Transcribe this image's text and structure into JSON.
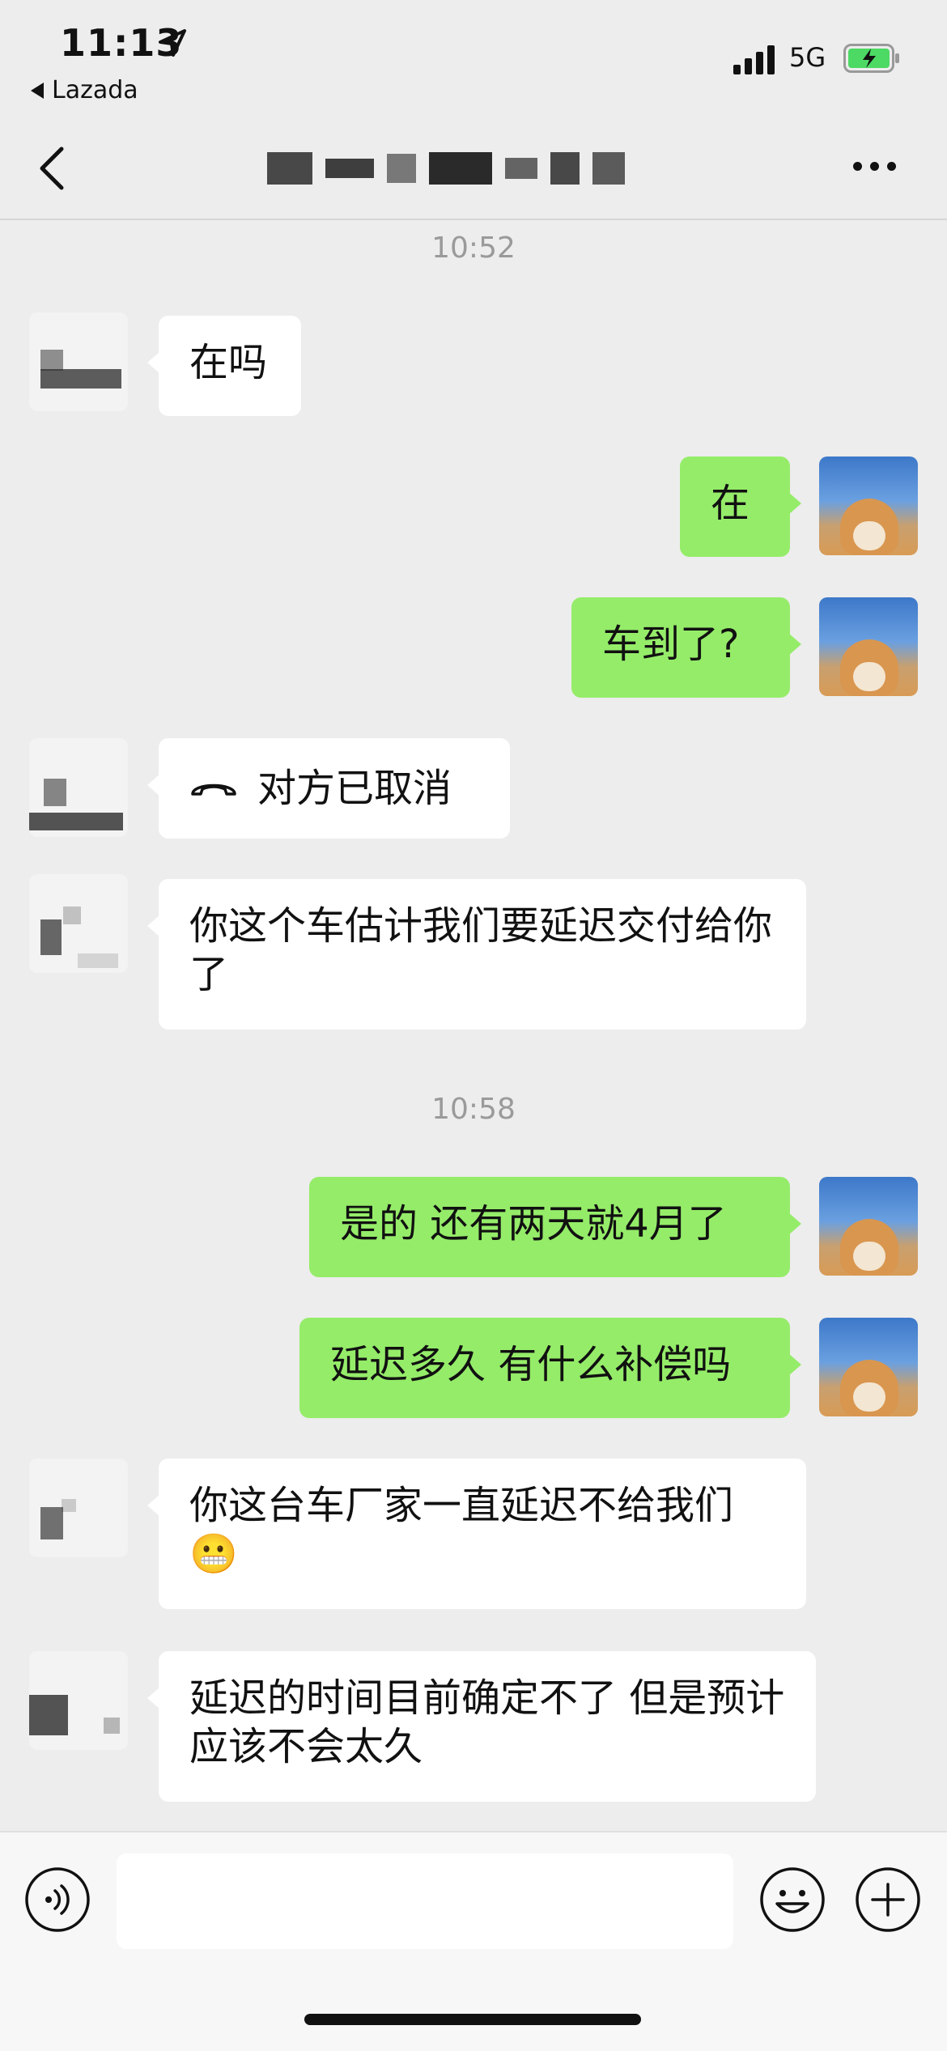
{
  "status_bar": {
    "time": "11:13",
    "back_app": "Lazada",
    "network": "5G"
  },
  "chat": {
    "title_obscured": true,
    "timestamps": [
      "10:52",
      "10:58"
    ],
    "messages": [
      {
        "from": "other",
        "text": "在吗"
      },
      {
        "from": "me",
        "text": "在"
      },
      {
        "from": "me",
        "text": "车到了?"
      },
      {
        "from": "other",
        "type": "call",
        "text": "对方已取消",
        "icon": "phone-hangup-icon"
      },
      {
        "from": "other",
        "text": "你这个车估计我们要延迟交付给你了"
      },
      {
        "from": "me",
        "text": "是的 还有两天就4月了"
      },
      {
        "from": "me",
        "text": "延迟多久 有什么补偿吗"
      },
      {
        "from": "other",
        "text": "你这台车厂家一直延迟不给我们",
        "emoji": "😬"
      },
      {
        "from": "other",
        "text": "延迟的时间目前确定不了 但是预计应该不会太久"
      }
    ]
  },
  "input_bar": {
    "icons": [
      "voice-icon",
      "emoji-icon",
      "plus-icon"
    ]
  },
  "colors": {
    "background": "#ededed",
    "my_bubble": "#95ec69",
    "other_bubble": "#ffffff"
  }
}
